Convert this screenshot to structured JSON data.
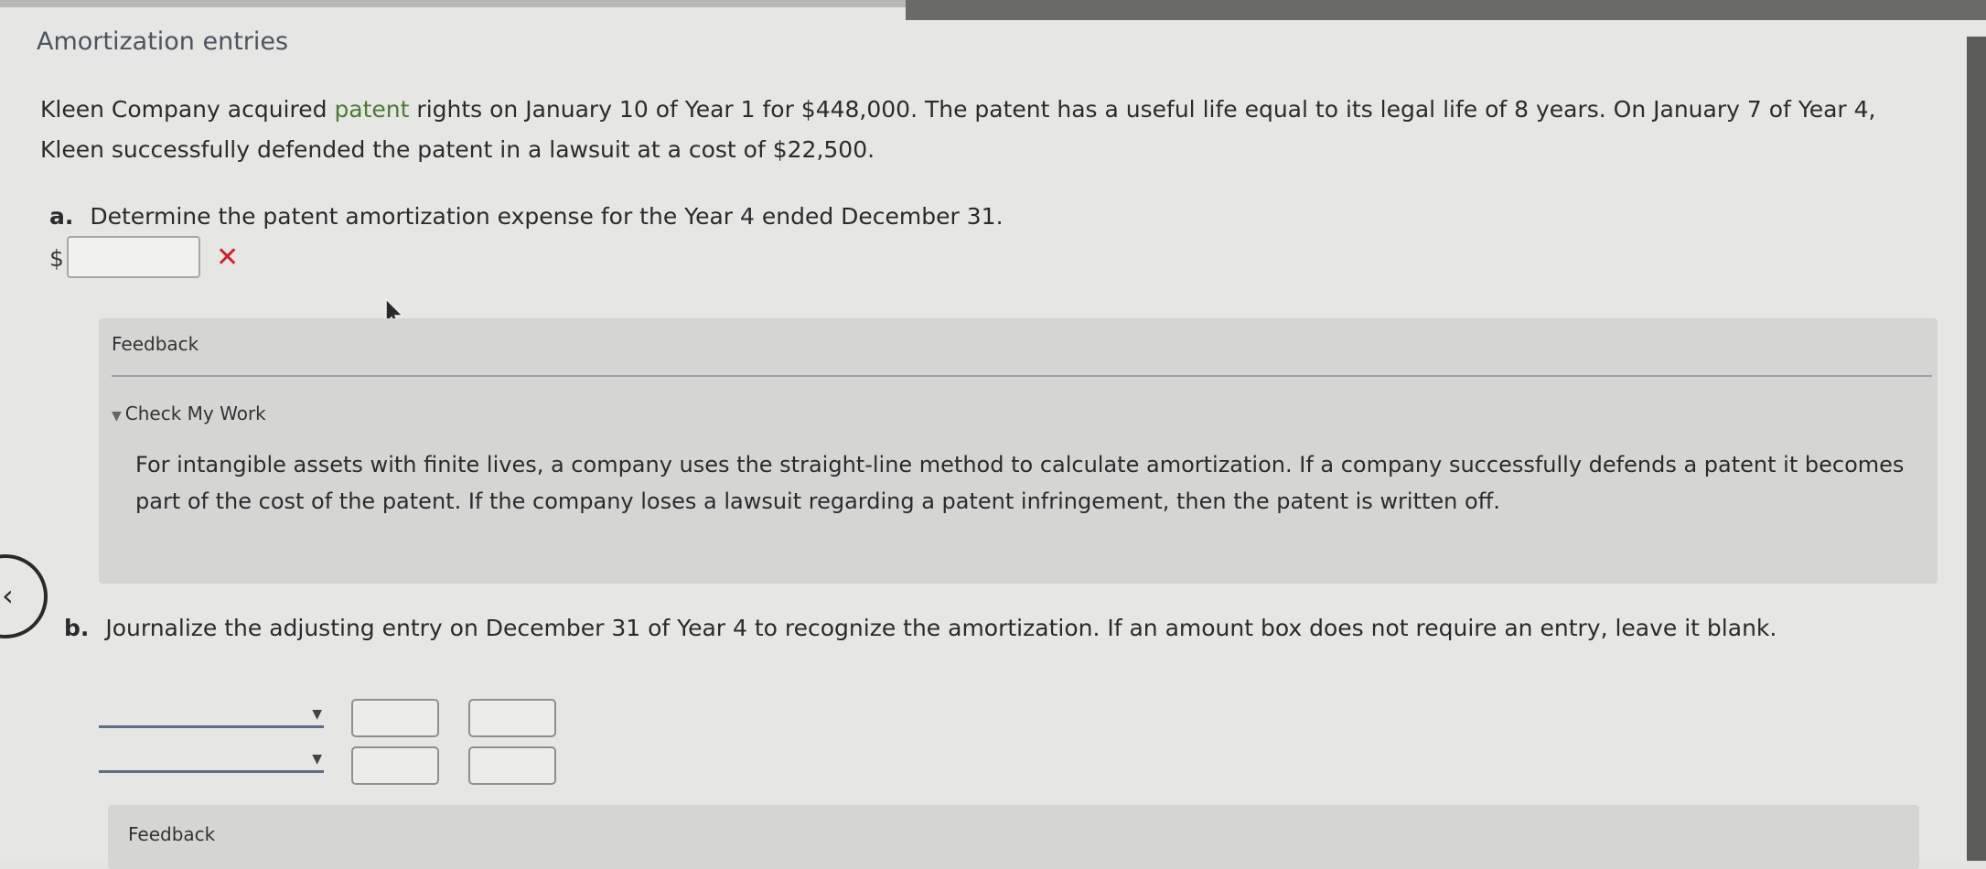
{
  "section_title": "Amortization entries",
  "problem": {
    "text_before": "Kleen Company acquired ",
    "highlight": "patent",
    "text_after": " rights on January 10 of Year 1 for $448,000. The patent has a useful life equal to its legal life of 8 years. On January 7 of Year 4, Kleen successfully defended the patent in a lawsuit at a cost of $22,500."
  },
  "part_a": {
    "label": "a.",
    "question": "Determine the patent amortization expense for the Year 4 ended December 31.",
    "currency_symbol": "$",
    "answer_value": "",
    "result_mark": "✕"
  },
  "feedback_a": {
    "title": "Feedback",
    "check_label": "Check My Work",
    "text": "For intangible assets with finite lives, a company uses the straight-line method to calculate amortization. If a company successfully defends a patent it becomes part of the cost of the patent. If the company loses a lawsuit regarding a patent infringement, then the patent is written off."
  },
  "part_b": {
    "label": "b.",
    "question": "Journalize the adjusting entry on December 31 of Year 4 to recognize the amortization. If an amount box does not require an entry, leave it blank."
  },
  "journal": {
    "rows": [
      {
        "account": "",
        "debit": "",
        "credit": ""
      },
      {
        "account": "",
        "debit": "",
        "credit": ""
      }
    ]
  },
  "feedback_b": {
    "title": "Feedback"
  },
  "colors": {
    "error": "#d0212a",
    "highlight": "#4c7a34",
    "panel": "#d5d6d4"
  }
}
